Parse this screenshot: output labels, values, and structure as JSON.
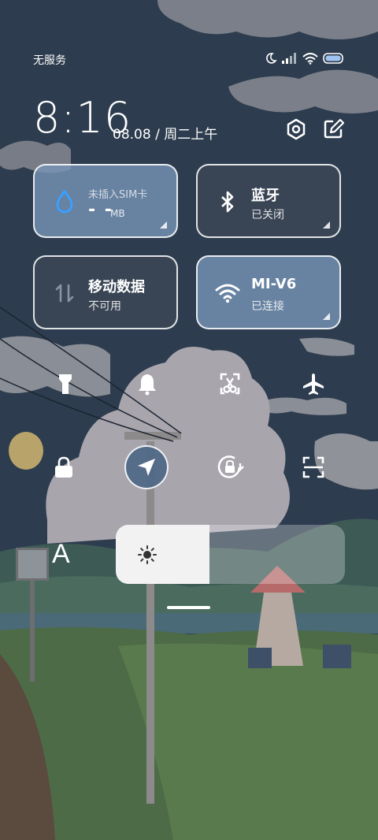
{
  "status_bar": {
    "carrier": "无服务",
    "icons": [
      "moon-icon",
      "signal-icon",
      "wifi-icon",
      "battery-icon"
    ]
  },
  "header": {
    "time": "8:16",
    "date": "08.08 / 周二上午",
    "icons": [
      "settings-icon",
      "edit-icon"
    ]
  },
  "tiles": [
    {
      "id": "sim",
      "small": "未插入SIM卡",
      "value": "- -",
      "unit": "MB",
      "icon": "water-drop-icon",
      "active": true
    },
    {
      "id": "bluetooth",
      "title": "蓝牙",
      "subtitle": "已关闭",
      "icon": "bluetooth-icon",
      "active": false
    },
    {
      "id": "mobile-data",
      "title": "移动数据",
      "subtitle": "不可用",
      "icon": "data-arrows-icon",
      "active": false
    },
    {
      "id": "wifi",
      "title": "MI-V6",
      "subtitle": "已连接",
      "icon": "wifi-icon",
      "active": true
    }
  ],
  "toggles": [
    {
      "name": "flashlight-icon",
      "active": false
    },
    {
      "name": "bell-icon",
      "active": false
    },
    {
      "name": "screenshot-icon",
      "active": false
    },
    {
      "name": "airplane-icon",
      "active": false
    },
    {
      "name": "lock-icon",
      "active": false
    },
    {
      "name": "location-icon",
      "active": true
    },
    {
      "name": "auto-rotate-icon",
      "active": false
    },
    {
      "name": "scan-icon",
      "active": false
    }
  ],
  "font_label": "A",
  "brightness": {
    "level": 0.41,
    "icon": "sun-icon"
  },
  "colors": {
    "active_tile": "#7896b9",
    "inactive_tile": "#3e4a58",
    "sky": "#2c3a4c"
  }
}
